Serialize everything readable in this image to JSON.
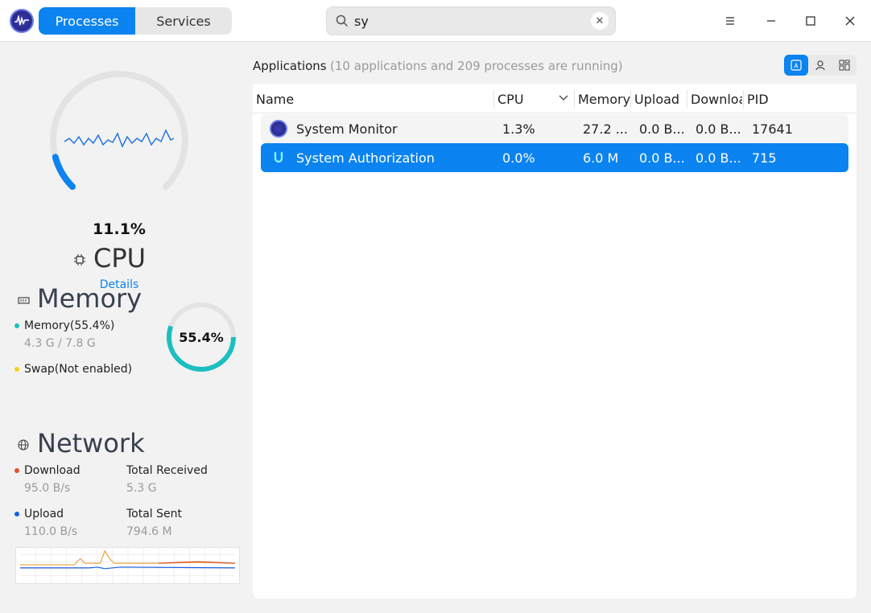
{
  "tabs": {
    "processes": "Processes",
    "services": "Services"
  },
  "search": {
    "value": "sy"
  },
  "cpu": {
    "percent": "11.1%",
    "title": "CPU",
    "details": "Details",
    "usage_fraction": 0.111
  },
  "memory": {
    "title": "Memory",
    "mem_label": "Memory(55.4%)",
    "mem_value": "4.3 G / 7.8 G",
    "swap_label": "Swap(Not enabled)",
    "ring_percent": "55.4%",
    "usage_fraction": 0.554,
    "mem_color": "#1bbfc0",
    "swap_color": "#f5d21b"
  },
  "network": {
    "title": "Network",
    "download_label": "Download",
    "download_value": "95.0 B/s",
    "total_received_label": "Total Received",
    "total_received_value": "5.3 G",
    "upload_label": "Upload",
    "upload_value": "110.0 B/s",
    "total_sent_label": "Total Sent",
    "total_sent_value": "794.6 M",
    "download_color": "#e0502d",
    "upload_color": "#1b5fe0"
  },
  "apps": {
    "title": "Applications",
    "subtitle": "(10 applications and 209 processes are running)",
    "columns": {
      "name": "Name",
      "cpu": "CPU",
      "memory": "Memory",
      "upload": "Upload",
      "download": "Downloa",
      "pid": "PID"
    },
    "rows": [
      {
        "name": "System Monitor",
        "cpu": "1.3%",
        "memory": "27.2 ...",
        "upload": "0.0 B...",
        "download": "0.0 B...",
        "pid": "17641"
      },
      {
        "name": "System Authorization",
        "cpu": "0.0%",
        "memory": "6.0 M",
        "upload": "0.0 B...",
        "download": "0.0 B...",
        "pid": "715"
      }
    ]
  },
  "accent": "#0b83f0"
}
